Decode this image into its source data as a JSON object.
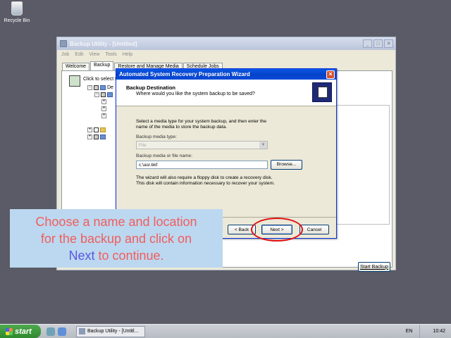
{
  "desktop": {
    "recycle_bin_label": "Recycle Bin"
  },
  "main_window": {
    "title": "Backup Utility - [Untitled]",
    "menu": [
      "Job",
      "Edit",
      "View",
      "Tools",
      "Help"
    ],
    "tabs": [
      "Welcome",
      "Backup",
      "Restore and Manage Media",
      "Schedule Jobs"
    ],
    "active_tab": "Backup",
    "click_label": "Click to select t",
    "tree_label": "De",
    "start_backup_label": "Start Backup"
  },
  "wizard": {
    "title": "Automated System Recovery Preparation Wizard",
    "header_title": "Backup Destination",
    "header_subtitle": "Where would you like the system backup to be saved?",
    "instructions": "Select a media type for your system backup, and then enter the name of the media to store the backup data.",
    "media_type_label": "Backup media type:",
    "media_type_value": "File",
    "media_name_label": "Backup media or file name:",
    "media_name_value": "c:\\asr.bkf",
    "browse_label": "Browse...",
    "floppy_note": "The wizard will also require a floppy disk to create a recovery disk. This disk will contain information necessary to recover your system.",
    "back_label": "< Back",
    "next_label": "Next >",
    "cancel_label": "Cancel"
  },
  "callout": {
    "line1": "Choose a name and location",
    "line2": "for the backup and click on",
    "keyword": "Next",
    "line3_rest": " to continue.",
    "text_color": "#f05d5d",
    "keyword_color": "#5a56e0"
  },
  "taskbar": {
    "start_label": "start",
    "task_label": "Backup Utility - [Untitl...",
    "language": "EN",
    "clock": "10:42"
  }
}
